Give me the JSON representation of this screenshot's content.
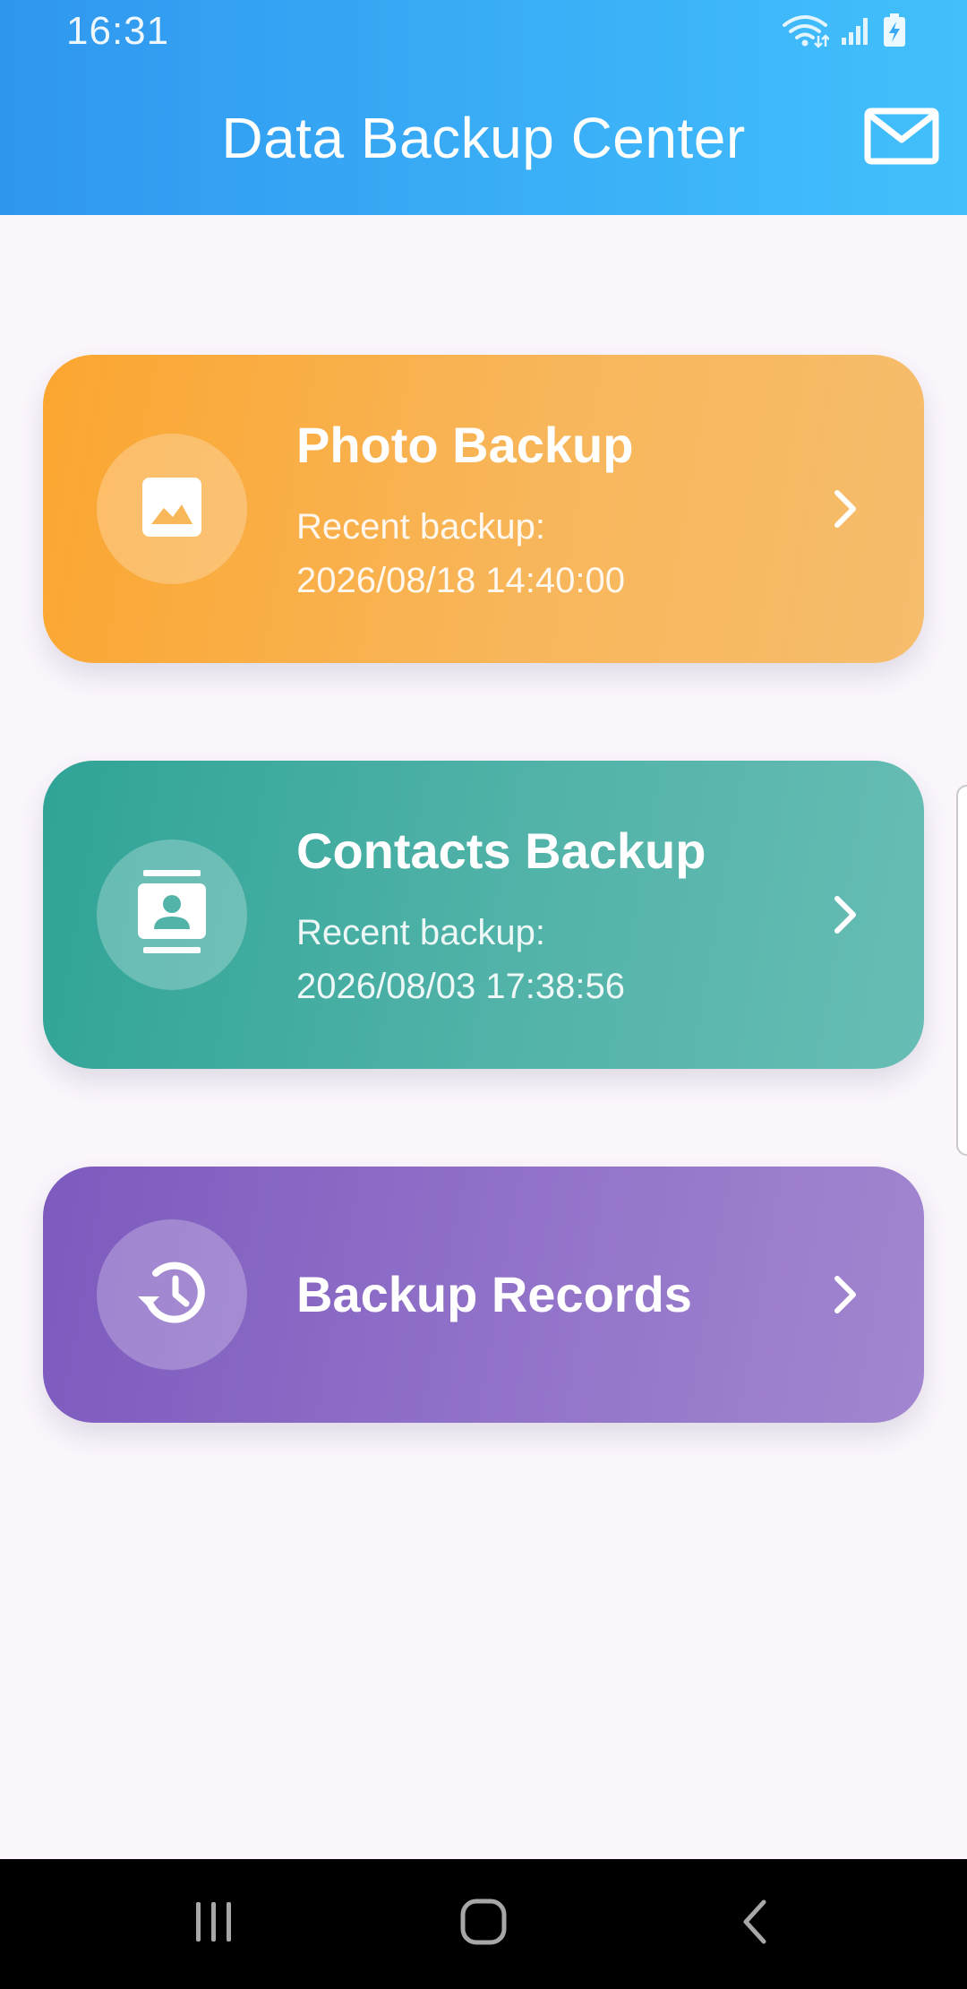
{
  "status_bar": {
    "time": "16:31",
    "icons": [
      "wifi-icon",
      "signal-icon",
      "battery-charging-icon"
    ]
  },
  "header": {
    "title": "Data Backup Center",
    "action_icon": "mail-icon",
    "gradient_colors": [
      "#2f97ee",
      "#42c0fb"
    ]
  },
  "cards": [
    {
      "id": "photo",
      "title": "Photo Backup",
      "subtitle_label": "Recent backup:",
      "subtitle_value": "2026/08/18 14:40:00",
      "icon": "image-icon",
      "color": "#fba630"
    },
    {
      "id": "contacts",
      "title": "Contacts Backup",
      "subtitle_label": "Recent backup:",
      "subtitle_value": "2026/08/03 17:38:56",
      "icon": "contacts-icon",
      "color": "#30a497"
    },
    {
      "id": "records",
      "title": "Backup Records",
      "icon": "history-icon",
      "color": "#7d5abe"
    }
  ],
  "nav_bar": {
    "buttons": [
      "recent-apps-icon",
      "home-icon",
      "back-icon"
    ]
  }
}
